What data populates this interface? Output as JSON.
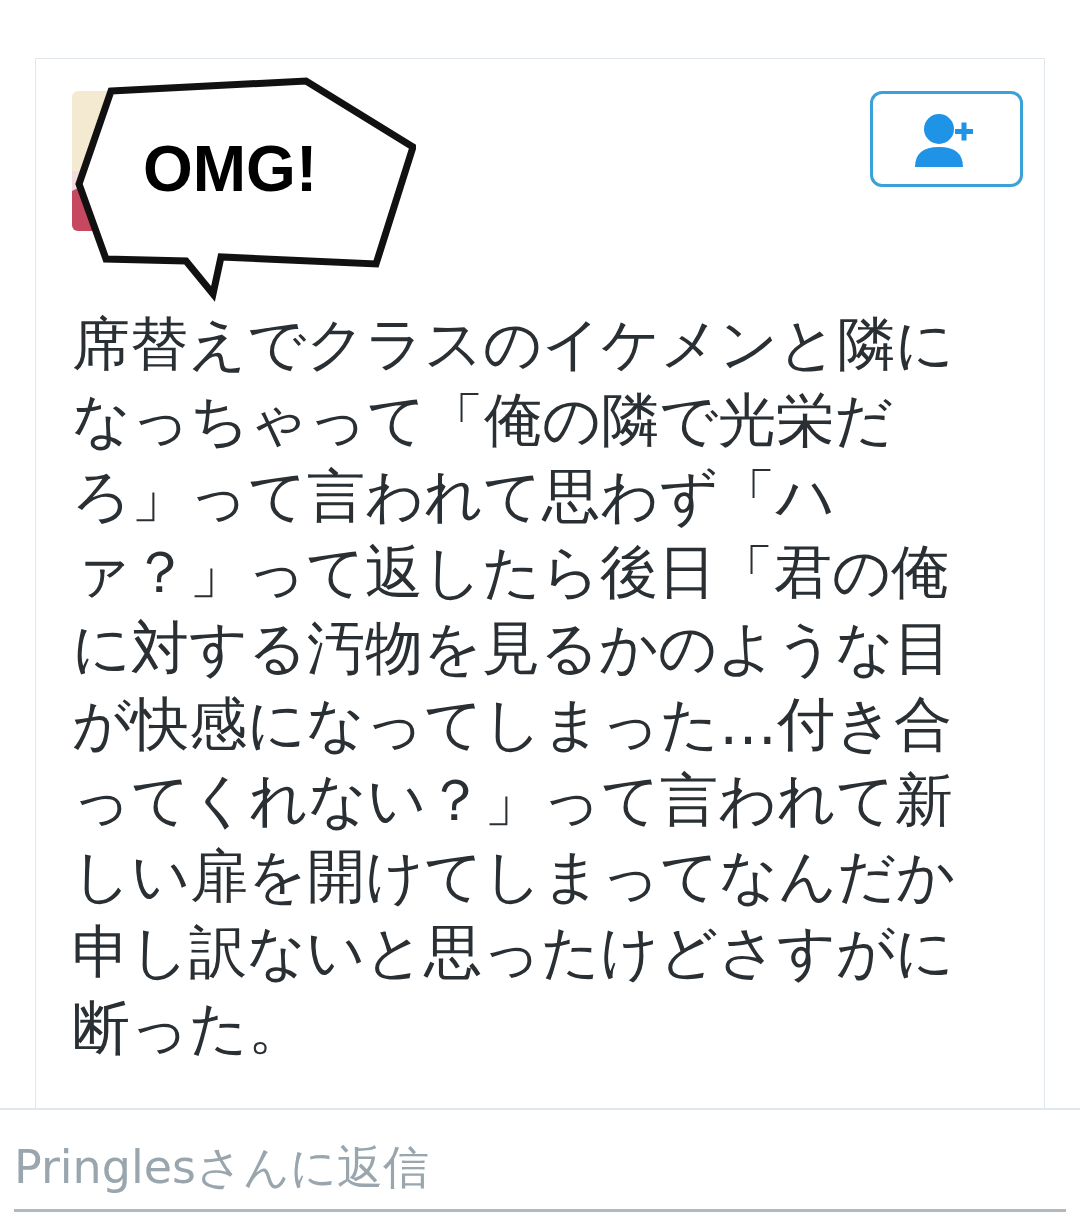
{
  "bubble": {
    "text": "OMG!"
  },
  "tweet": {
    "lines": [
      "席替えでクラスのイケメンと隣に",
      "なっちゃって「俺の隣で光栄だ",
      "ろ」って言われて思わず「ハ",
      "ァ？」って返したら後日「君の俺",
      "に対する汚物を見るかのような目",
      "が快感になってしまった…付き合",
      "ってくれない？」って言われて新",
      "しい扉を開けてしまってなんだか",
      "申し訳ないと思ったけどさすがに",
      "断った。"
    ]
  },
  "reply": {
    "placeholder": "Pringlesさんに返信"
  }
}
